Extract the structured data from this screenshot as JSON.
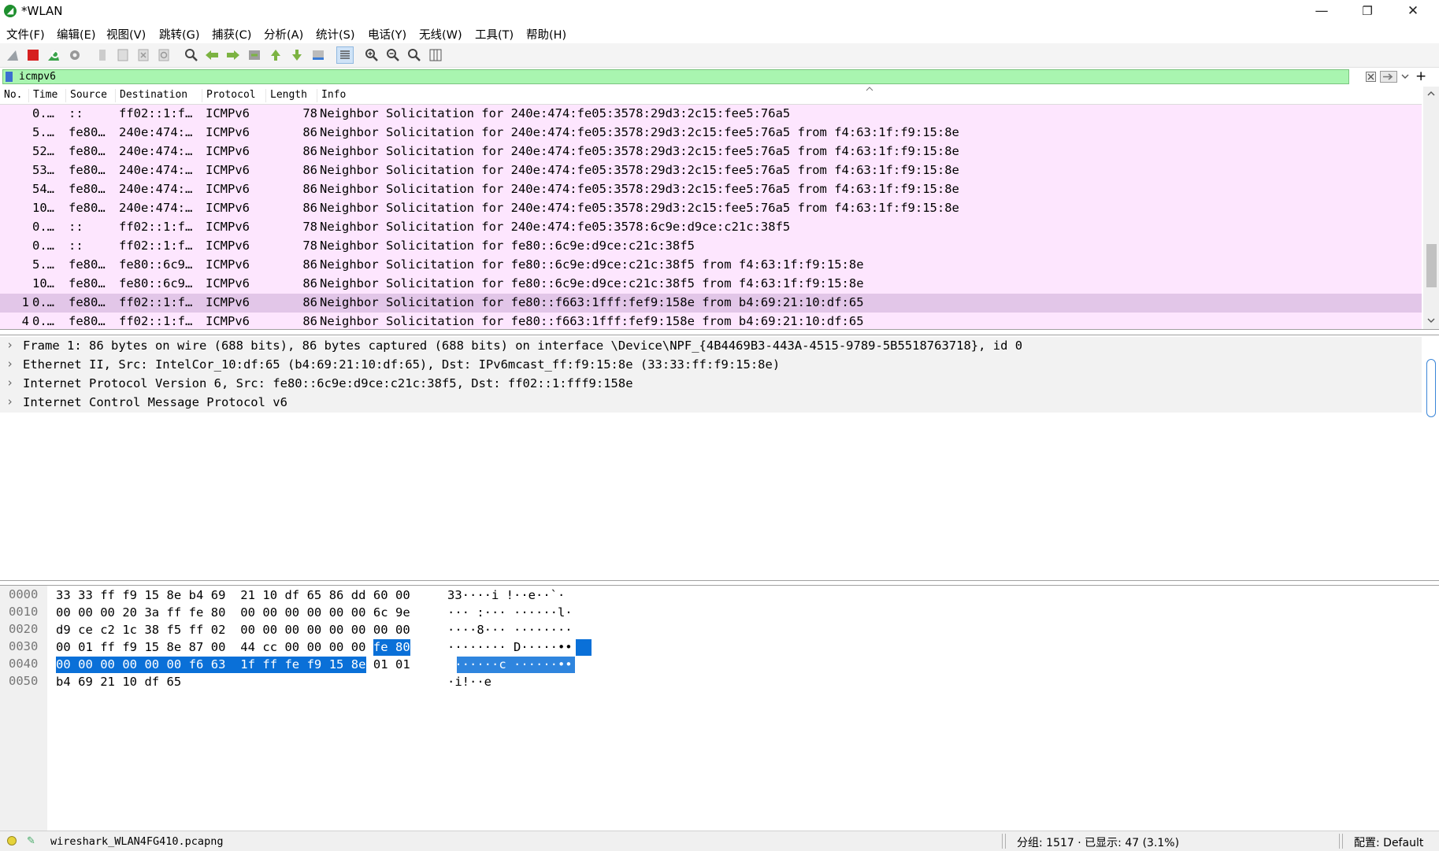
{
  "window": {
    "title": "*WLAN",
    "icon": "wireshark-fin-icon",
    "minimize_glyph": "—",
    "restore_glyph": "❐",
    "close_glyph": "✕"
  },
  "menu": [
    "文件(F)",
    "编辑(E)",
    "视图(V)",
    "跳转(G)",
    "捕获(C)",
    "分析(A)",
    "统计(S)",
    "电话(Y)",
    "无线(W)",
    "工具(T)",
    "帮助(H)"
  ],
  "toolbar": [
    "start-capture-icon",
    "stop-capture-icon",
    "restart-capture-icon",
    "capture-options-icon",
    "open-file-icon",
    "save-file-icon",
    "close-file-icon",
    "reload-file-icon",
    "find-packet-icon",
    "go-back-icon",
    "go-forward-icon",
    "go-to-packet-icon",
    "go-first-icon",
    "go-last-icon",
    "auto-scroll-icon",
    "colorize-icon",
    "zoom-in-icon",
    "zoom-out-icon",
    "zoom-normal-icon",
    "resize-columns-icon"
  ],
  "filter": {
    "value": "icmpv6",
    "add_glyph": "+"
  },
  "packet_list": {
    "columns": [
      "No.",
      "Time",
      "Source",
      "Destination",
      "Protocol",
      "Length",
      "Info"
    ],
    "rows": [
      {
        "no": "",
        "time": "0.…",
        "src": "::",
        "dst": "ff02::1:f…",
        "proto": "ICMPv6",
        "len": "78",
        "info": "Neighbor Solicitation for 240e:474:fe05:3578:29d3:2c15:fee5:76a5"
      },
      {
        "no": "",
        "time": "5.…",
        "src": "fe80…",
        "dst": "240e:474:…",
        "proto": "ICMPv6",
        "len": "86",
        "info": "Neighbor Solicitation for 240e:474:fe05:3578:29d3:2c15:fee5:76a5 from f4:63:1f:f9:15:8e"
      },
      {
        "no": "",
        "time": "52…",
        "src": "fe80…",
        "dst": "240e:474:…",
        "proto": "ICMPv6",
        "len": "86",
        "info": "Neighbor Solicitation for 240e:474:fe05:3578:29d3:2c15:fee5:76a5 from f4:63:1f:f9:15:8e"
      },
      {
        "no": "",
        "time": "53…",
        "src": "fe80…",
        "dst": "240e:474:…",
        "proto": "ICMPv6",
        "len": "86",
        "info": "Neighbor Solicitation for 240e:474:fe05:3578:29d3:2c15:fee5:76a5 from f4:63:1f:f9:15:8e"
      },
      {
        "no": "",
        "time": "54…",
        "src": "fe80…",
        "dst": "240e:474:…",
        "proto": "ICMPv6",
        "len": "86",
        "info": "Neighbor Solicitation for 240e:474:fe05:3578:29d3:2c15:fee5:76a5 from f4:63:1f:f9:15:8e"
      },
      {
        "no": "",
        "time": "10…",
        "src": "fe80…",
        "dst": "240e:474:…",
        "proto": "ICMPv6",
        "len": "86",
        "info": "Neighbor Solicitation for 240e:474:fe05:3578:29d3:2c15:fee5:76a5 from f4:63:1f:f9:15:8e"
      },
      {
        "no": "",
        "time": "0.…",
        "src": "::",
        "dst": "ff02::1:f…",
        "proto": "ICMPv6",
        "len": "78",
        "info": "Neighbor Solicitation for 240e:474:fe05:3578:6c9e:d9ce:c21c:38f5"
      },
      {
        "no": "",
        "time": "0.…",
        "src": "::",
        "dst": "ff02::1:f…",
        "proto": "ICMPv6",
        "len": "78",
        "info": "Neighbor Solicitation for fe80::6c9e:d9ce:c21c:38f5"
      },
      {
        "no": "",
        "time": "5.…",
        "src": "fe80…",
        "dst": "fe80::6c9…",
        "proto": "ICMPv6",
        "len": "86",
        "info": "Neighbor Solicitation for fe80::6c9e:d9ce:c21c:38f5 from f4:63:1f:f9:15:8e"
      },
      {
        "no": "",
        "time": "10…",
        "src": "fe80…",
        "dst": "fe80::6c9…",
        "proto": "ICMPv6",
        "len": "86",
        "info": "Neighbor Solicitation for fe80::6c9e:d9ce:c21c:38f5 from f4:63:1f:f9:15:8e"
      },
      {
        "no": "1",
        "time": "0.…",
        "src": "fe80…",
        "dst": "ff02::1:f…",
        "proto": "ICMPv6",
        "len": "86",
        "info": "Neighbor Solicitation for fe80::f663:1fff:fef9:158e from b4:69:21:10:df:65",
        "selected": true
      },
      {
        "no": "4",
        "time": "0.…",
        "src": "fe80…",
        "dst": "ff02::1:f…",
        "proto": "ICMPv6",
        "len": "86",
        "info": "Neighbor Solicitation for fe80::f663:1fff:fef9:158e from b4:69:21:10:df:65"
      }
    ]
  },
  "details": [
    "Frame 1: 86 bytes on wire (688 bits), 86 bytes captured (688 bits) on interface \\Device\\NPF_{4B4469B3-443A-4515-9789-5B5518763718}, id 0",
    "Ethernet II, Src: IntelCor_10:df:65 (b4:69:21:10:df:65), Dst: IPv6mcast_ff:f9:15:8e (33:33:ff:f9:15:8e)",
    "Internet Protocol Version 6, Src: fe80::6c9e:d9ce:c21c:38f5, Dst: ff02::1:fff9:158e",
    "Internet Control Message Protocol v6"
  ],
  "bytes": [
    {
      "offset": "0000",
      "hex": [
        "33",
        "33",
        "ff",
        "f9",
        "15",
        "8e",
        "b4",
        "69",
        "21",
        "10",
        "df",
        "65",
        "86",
        "dd",
        "60",
        "00"
      ],
      "ascii": "33····i !··e··`·"
    },
    {
      "offset": "0010",
      "hex": [
        "00",
        "00",
        "00",
        "20",
        "3a",
        "ff",
        "fe",
        "80",
        "00",
        "00",
        "00",
        "00",
        "00",
        "00",
        "6c",
        "9e"
      ],
      "ascii": "··· :··· ······l·"
    },
    {
      "offset": "0020",
      "hex": [
        "d9",
        "ce",
        "c2",
        "1c",
        "38",
        "f5",
        "ff",
        "02",
        "00",
        "00",
        "00",
        "00",
        "00",
        "00",
        "00",
        "00"
      ],
      "ascii": "····8··· ········"
    },
    {
      "offset": "0030",
      "hex": [
        "00",
        "01",
        "ff",
        "f9",
        "15",
        "8e",
        "87",
        "00",
        "44",
        "cc",
        "00",
        "00",
        "00",
        "00",
        "fe",
        "80"
      ],
      "ascii": "········ D·····••",
      "hl_from": 14
    },
    {
      "offset": "0040",
      "hex": [
        "00",
        "00",
        "00",
        "00",
        "00",
        "00",
        "f6",
        "63",
        "1f",
        "ff",
        "fe",
        "f9",
        "15",
        "8e",
        "01",
        "01"
      ],
      "ascii": "·······c ······••",
      "hl_to": 13
    },
    {
      "offset": "0050",
      "hex": [
        "b4",
        "69",
        "21",
        "10",
        "df",
        "65"
      ],
      "ascii": "·i!··e"
    }
  ],
  "status": {
    "file": "wireshark_WLAN4FG410.pcapng",
    "counts": "分组: 1517 · 已显示: 47 (3.1%)",
    "profile": "配置: Default"
  }
}
